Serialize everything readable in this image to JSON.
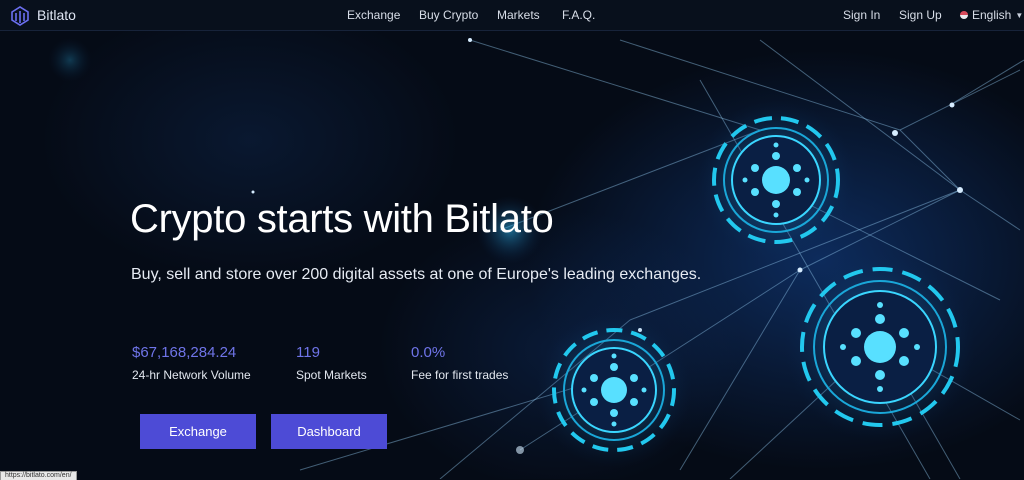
{
  "brand": {
    "name": "Bitlato"
  },
  "nav": {
    "items": [
      {
        "label": "Exchange"
      },
      {
        "label": "Buy Crypto"
      },
      {
        "label": "Markets"
      },
      {
        "label": "F.A.Q."
      }
    ],
    "sign_in": "Sign In",
    "sign_up": "Sign Up",
    "language": "English"
  },
  "hero": {
    "title": "Crypto starts with Bitlato",
    "subtitle": "Buy, sell and store over 200 digital assets at one of Europe's leading exchanges."
  },
  "stats": [
    {
      "value": "$67,168,284.24",
      "label": "24-hr Network Volume"
    },
    {
      "value": "119",
      "label": "Spot Markets"
    },
    {
      "value": "0.0%",
      "label": "Fee for first trades"
    }
  ],
  "buttons": {
    "exchange": "Exchange",
    "dashboard": "Dashboard"
  },
  "status_bar": {
    "url": "https://bitlato.com/en/"
  },
  "colors": {
    "accent": "#4d4bd6",
    "stat_value": "#6f74e8",
    "background": "#050b16",
    "node_glow": "#22c8ee"
  }
}
